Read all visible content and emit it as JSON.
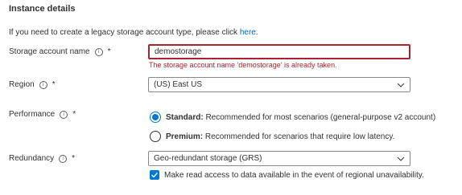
{
  "section": {
    "title": "Instance details"
  },
  "intro": {
    "text": "If you need to create a legacy storage account type, please click ",
    "link": "here",
    "suffix": "."
  },
  "storage_account_name": {
    "label": "Storage account name",
    "required": "*",
    "value": "demostorage",
    "error": "The storage account name 'demostorage' is already taken."
  },
  "region": {
    "label": "Region",
    "required": "*",
    "value": "(US) East US"
  },
  "performance": {
    "label": "Performance",
    "required": "*",
    "options": [
      {
        "title": "Standard:",
        "desc": "Recommended for most scenarios (general-purpose v2 account)",
        "selected": true
      },
      {
        "title": "Premium:",
        "desc": "Recommended for scenarios that require low latency.",
        "selected": false
      }
    ]
  },
  "redundancy": {
    "label": "Redundancy",
    "required": "*",
    "value": "Geo-redundant storage (GRS)",
    "checkbox_label": "Make read access to data available in the event of regional unavailability.",
    "checkbox_checked": true
  },
  "icons": {
    "info": "info-icon",
    "dropdown": "chevron-down-icon",
    "check": "checkmark-icon"
  },
  "colors": {
    "accent": "#0078d4",
    "error": "#a4262c",
    "link": "#0066b4"
  }
}
